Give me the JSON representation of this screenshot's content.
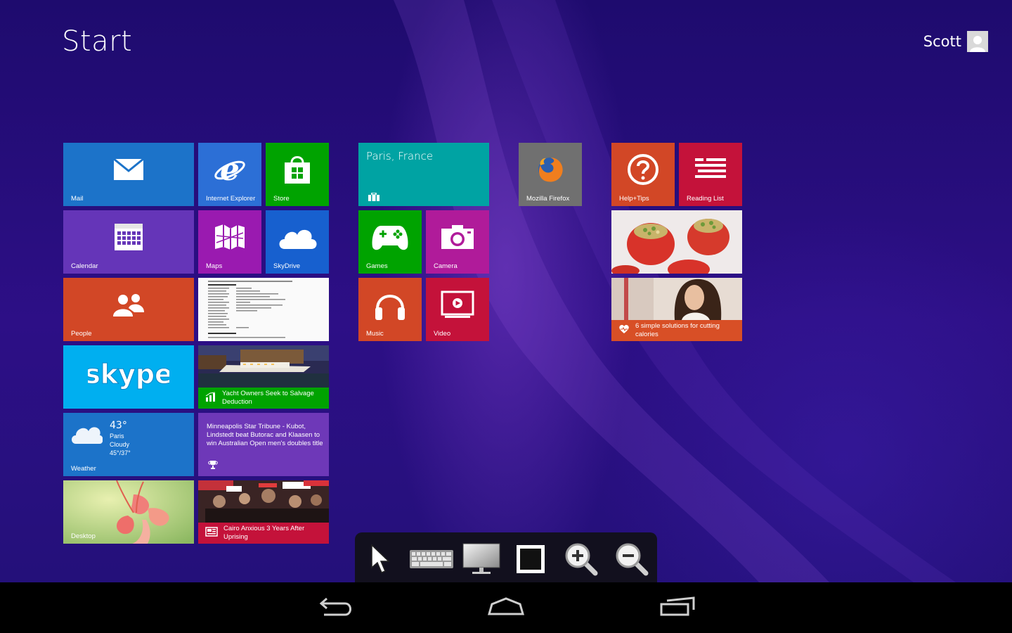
{
  "header": {
    "title": "Start",
    "user_name": "Scott"
  },
  "tiles": {
    "mail": {
      "label": "Mail",
      "icon": "mail-icon",
      "color": "#1c73c9"
    },
    "ie": {
      "label": "Internet Explorer",
      "icon": "internet-explorer-icon",
      "color": "#2c6fd6"
    },
    "store": {
      "label": "Store",
      "icon": "store-icon",
      "color": "#00a300"
    },
    "calendar": {
      "label": "Calendar",
      "icon": "calendar-icon",
      "color": "#6535b8"
    },
    "maps": {
      "label": "Maps",
      "icon": "maps-icon",
      "color": "#9a1ab0"
    },
    "skydrive": {
      "label": "SkyDrive",
      "icon": "cloud-icon",
      "color": "#1760cf"
    },
    "people": {
      "label": "People",
      "icon": "people-icon",
      "color": "#d24726"
    },
    "document": {
      "label": "",
      "icon": "document-preview"
    },
    "skype": {
      "label": "skype",
      "icon": "skype-icon",
      "color": "#00aff0"
    },
    "finance": {
      "headline": "Yacht Owners Seek to Salvage Deduction",
      "icon": "finance-chart-icon",
      "color": "#00a300"
    },
    "weather": {
      "label": "Weather",
      "temp": "43°",
      "city": "Paris",
      "condition": "Cloudy",
      "range": "45°/37°",
      "icon": "cloud-sun-icon",
      "color": "#1c73c9"
    },
    "sports": {
      "headline": "Minneapolis Star Tribune - Kubot, Lindstedt beat Butorac and Klaasen to win Australian Open men's doubles title",
      "icon": "trophy-icon",
      "color": "#6e38b8"
    },
    "desktop": {
      "label": "Desktop",
      "icon": "desktop-flower-image"
    },
    "news": {
      "headline": "Cairo Anxious 3 Years After Uprising",
      "icon": "newspaper-icon",
      "color": "#c4123a"
    },
    "travel": {
      "label": "Paris, France",
      "icon": "suitcase-icon",
      "color": "#00a3a3"
    },
    "games": {
      "label": "Games",
      "icon": "gamepad-icon",
      "color": "#00a300"
    },
    "camera": {
      "label": "Camera",
      "icon": "camera-icon",
      "color": "#b01b9a"
    },
    "music": {
      "label": "Music",
      "icon": "headphones-icon",
      "color": "#d24726"
    },
    "video": {
      "label": "Video",
      "icon": "video-icon",
      "color": "#c4123a"
    },
    "firefox": {
      "label": "Mozilla Firefox",
      "icon": "firefox-icon",
      "color": "#707070"
    },
    "help": {
      "label": "Help+Tips",
      "icon": "help-icon",
      "color": "#d24726"
    },
    "reading": {
      "label": "Reading List",
      "icon": "reading-list-icon",
      "color": "#c4123a"
    },
    "food": {
      "label": "",
      "icon": "stuffed-tomatoes-image"
    },
    "health": {
      "headline": "6 simple solutions for cutting calories",
      "icon": "health-heart-icon",
      "color": "#d84f26"
    }
  },
  "toolbar": {
    "tools": [
      {
        "name": "pointer",
        "icon": "mouse-pointer-icon"
      },
      {
        "name": "keyboard",
        "icon": "keyboard-icon"
      },
      {
        "name": "display",
        "icon": "monitor-icon"
      },
      {
        "name": "fullscreen",
        "icon": "fullscreen-icon"
      },
      {
        "name": "zoom-in",
        "icon": "zoom-in-icon"
      },
      {
        "name": "zoom-out",
        "icon": "zoom-out-icon"
      }
    ]
  },
  "navbar": {
    "buttons": [
      {
        "name": "back",
        "icon": "back-icon"
      },
      {
        "name": "home",
        "icon": "home-icon"
      },
      {
        "name": "recents",
        "icon": "recent-apps-icon"
      }
    ]
  }
}
